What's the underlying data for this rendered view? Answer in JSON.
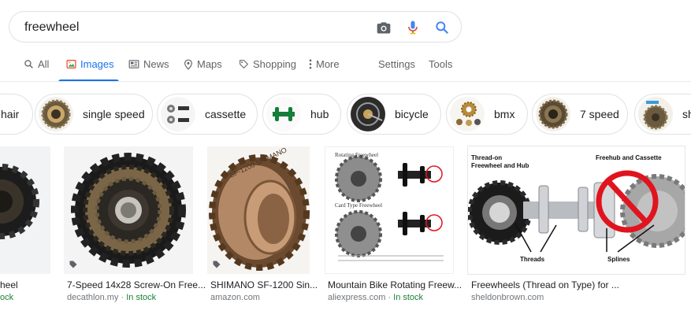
{
  "search": {
    "query": "freewheel"
  },
  "tabs": [
    {
      "label": "All"
    },
    {
      "label": "Images"
    },
    {
      "label": "News"
    },
    {
      "label": "Maps"
    },
    {
      "label": "Shopping"
    },
    {
      "label": "More"
    },
    {
      "label": "Settings"
    },
    {
      "label": "Tools"
    }
  ],
  "chips": [
    {
      "label": "hair"
    },
    {
      "label": "single speed"
    },
    {
      "label": "cassette"
    },
    {
      "label": "hub"
    },
    {
      "label": "bicycle"
    },
    {
      "label": "bmx"
    },
    {
      "label": "7 speed"
    },
    {
      "label": "sh"
    }
  ],
  "results": [
    {
      "title": "heel",
      "source": "",
      "stock": "ock"
    },
    {
      "title": "7-Speed 14x28 Screw-On Free...",
      "source": "decathlon.my",
      "sep": " · ",
      "stock": "In stock"
    },
    {
      "title": "SHIMANO SF-1200 Sin...",
      "source": "amazon.com"
    },
    {
      "title": "Mountain Bike Rotating Freew...",
      "source": "aliexpress.com",
      "sep": " · ",
      "stock": "In stock"
    },
    {
      "title": "Freewheels (Thread on Type) for ...",
      "source": "sheldonbrown.com"
    }
  ],
  "diagram": {
    "rotating": "Rotating Freewheel",
    "cardtype": "Card Type Freewheel",
    "left_head": "Thread-on Freewheel and Hub",
    "right_head": "Freehub and Cassette",
    "threads": "Threads",
    "splines": "Splines"
  },
  "colors": {
    "accent": "#1a73e8",
    "instock": "#188038",
    "no_sign": "#e0141e"
  }
}
